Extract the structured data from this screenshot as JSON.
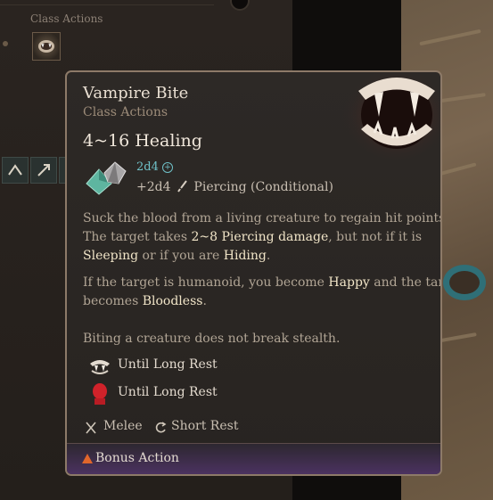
{
  "background": {
    "class_actions_label": "Class Actions"
  },
  "tooltip": {
    "title": "Vampire Bite",
    "subtitle": "Class Actions",
    "effect": "4~16 Healing",
    "dice_primary": "2d4",
    "dice_secondary_amount": "+2d4",
    "dice_secondary_type": "Piercing (Conditional)",
    "description": {
      "p1_line1": "Suck the blood from a living creature to regain hit points.",
      "p1_line2_a": "The target takes ",
      "p1_line2_b": "2~8 Piercing damage",
      "p1_line2_c": ", but not if it is",
      "p1_line3_a": "Sleeping",
      "p1_line3_b": " or if you are ",
      "p1_line3_c": "Hiding",
      "p1_line3_d": ".",
      "p2_line1_a": "If the target is humanoid, you become ",
      "p2_line1_b": "Happy",
      "p2_line1_c": " and the target",
      "p2_line2_a": "becomes ",
      "p2_line2_b": "Bloodless",
      "p2_line2_c": ".",
      "p3": "Biting a creature does not break stealth."
    },
    "conditions": [
      {
        "icon": "fangs-icon",
        "label": "Until Long Rest"
      },
      {
        "icon": "red-head-icon",
        "label": "Until Long Rest"
      }
    ],
    "footer": {
      "range": "Melee",
      "recharge": "Short Rest"
    },
    "action_type": "Bonus Action",
    "colors": {
      "dice": "#6fc1c8",
      "highlight": "#f1e5c8",
      "bonus_bar": "#4b3260",
      "border": "#8d7a68"
    }
  }
}
